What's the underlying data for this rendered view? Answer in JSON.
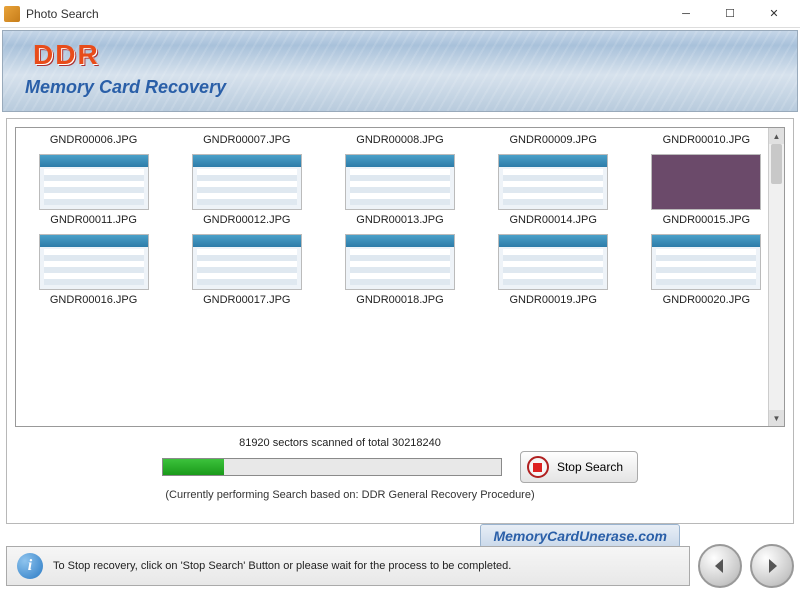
{
  "window": {
    "title": "Photo Search"
  },
  "banner": {
    "logo": "DDR",
    "subtitle": "Memory Card Recovery"
  },
  "files": [
    "GNDR00006.JPG",
    "GNDR00007.JPG",
    "GNDR00008.JPG",
    "GNDR00009.JPG",
    "GNDR00010.JPG",
    "GNDR00011.JPG",
    "GNDR00012.JPG",
    "GNDR00013.JPG",
    "GNDR00014.JPG",
    "GNDR00015.JPG",
    "GNDR00016.JPG",
    "GNDR00017.JPG",
    "GNDR00018.JPG",
    "GNDR00019.JPG",
    "GNDR00020.JPG"
  ],
  "solid_index": 9,
  "progress": {
    "label": "81920 sectors scanned of total 30218240",
    "percent": 18,
    "procedure": "(Currently performing Search based on:  DDR General Recovery Procedure)",
    "stop_label": "Stop Search"
  },
  "footer": {
    "info": "To Stop recovery, click on 'Stop Search' Button or please wait for the process to be completed.",
    "branding": "MemoryCardUnerase.com"
  }
}
